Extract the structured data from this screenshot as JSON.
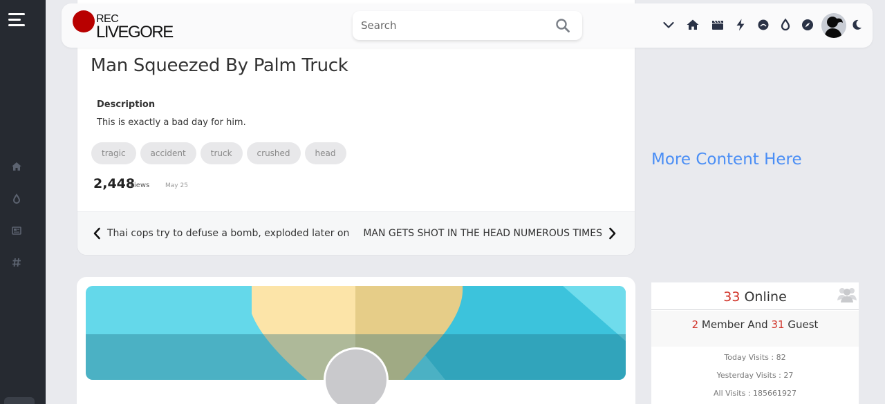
{
  "header": {
    "logo_top": "REC",
    "logo_bottom": "LIVEGORE",
    "search_placeholder": "Search",
    "icons": [
      "chevron-down-icon",
      "home-icon",
      "clapperboard-icon",
      "bolt-icon",
      "bullet-icon",
      "drop-icon",
      "compass-icon",
      "avatar",
      "moon-icon"
    ]
  },
  "sidebar": {
    "icons": [
      "home-icon",
      "drop-icon",
      "news-icon",
      "hashtag-icon"
    ]
  },
  "post": {
    "title": "Man Squeezed By Palm Truck",
    "description_label": "Description",
    "description": "This is exactly a bad day for him.",
    "tags": [
      "tragic",
      "accident",
      "truck",
      "crushed",
      "head"
    ],
    "views": "2,448",
    "views_label": "views",
    "date": "May 25",
    "prev_title": "Thai cops try to defuse a bomb, exploded later on",
    "next_title": "MAN GETS SHOT IN THE HEAD NUMEROUS TIMES"
  },
  "aside": {
    "more_content": "More Content Here"
  },
  "online": {
    "count": "33",
    "label": "Online",
    "members": "2",
    "members_label": "Member And",
    "guests": "31",
    "guests_label": "Guest",
    "today": "Today Visits : 82",
    "yesterday": "Yesterday Visits : 27",
    "all": "All Visits : 185661927"
  },
  "colors": {
    "accent_red": "#d1342a",
    "link_blue": "#4a8ef5",
    "logo_red": "#b80000",
    "sidebar_bg": "#262a31",
    "page_bg": "#e9eaee"
  }
}
